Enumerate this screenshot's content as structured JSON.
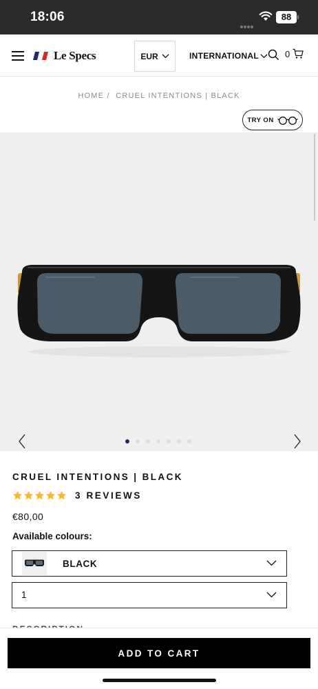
{
  "status_bar": {
    "time": "18:06",
    "battery": "88"
  },
  "header": {
    "brand": "Le Specs",
    "currency": "EUR",
    "region": "INTERNATIONAL",
    "cart_count": "0",
    "flag_colors": [
      "#1d2c6b",
      "#ffffff",
      "#d8262e"
    ]
  },
  "breadcrumb": {
    "home": "HOME",
    "separator": "/",
    "current": "CRUEL INTENTIONS | BLACK"
  },
  "try_on_label": "TRY ON",
  "gallery": {
    "slide_count": 7,
    "active_index": 0
  },
  "product": {
    "title": "CRUEL INTENTIONS | BLACK",
    "rating": 5,
    "reviews_label": "3 REVIEWS",
    "price": "€80,00",
    "colours_label": "Available colours:",
    "selected_colour": "BLACK",
    "quantity": "1",
    "description_heading": "DESCRIPTION"
  },
  "add_to_cart_label": "ADD TO CART",
  "colors": {
    "star": "#f5b92e",
    "accent_dot": "#1e2a55",
    "button_bg": "#000000"
  },
  "icons": [
    "menu-icon",
    "search-icon",
    "cart-icon",
    "chevron-down-icon",
    "glasses-icon",
    "chevron-left-icon",
    "chevron-right-icon",
    "star-icon",
    "wifi-icon",
    "battery-icon"
  ]
}
